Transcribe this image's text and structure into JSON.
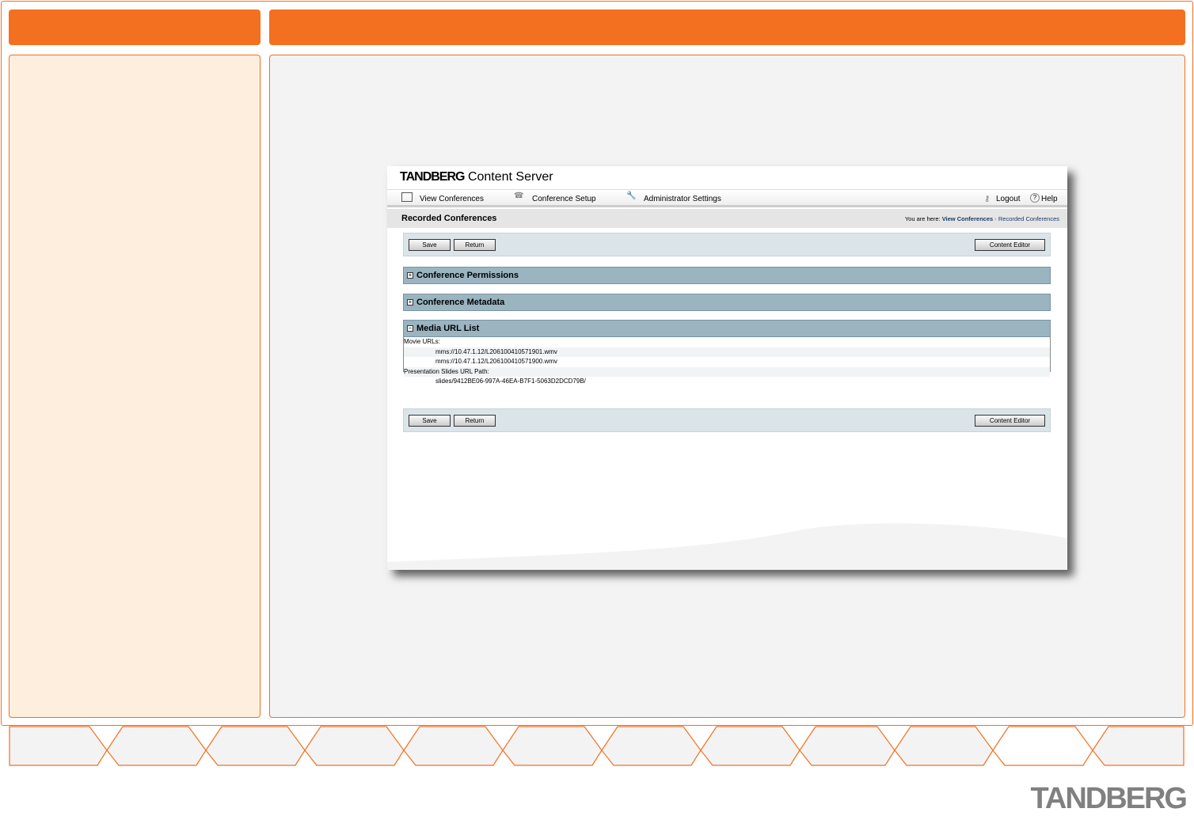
{
  "app": {
    "brand": "TANDBERG",
    "product": "Content Server"
  },
  "nav": {
    "view_conferences": "View Conferences",
    "conference_setup": "Conference Setup",
    "admin_settings": "Administrator Settings",
    "logout": "Logout",
    "help": "Help"
  },
  "page": {
    "title": "Recorded Conferences",
    "you_are_here": "You are here:",
    "crumb1": "View Conferences",
    "crumb2": "Recorded Conferences"
  },
  "buttons": {
    "save": "Save",
    "return": "Return",
    "content_editor": "Content Editor"
  },
  "sections": {
    "permissions": "Conference Permissions",
    "metadata": "Conference Metadata",
    "media": "Media URL List"
  },
  "media": {
    "movie_label": "Movie URLs:",
    "url1": "mms://10.47.1.12/L206100410571901.wmv",
    "url2": "mms://10.47.1.12/L206100410571900.wmv",
    "slides_label": "Presentation Slides URL Path:",
    "slides_path": "slides/9412BE06-997A-46EA-B7F1-5063D2DCD79B/"
  },
  "footer_logo": "TANDBERG",
  "active_tab": 11
}
